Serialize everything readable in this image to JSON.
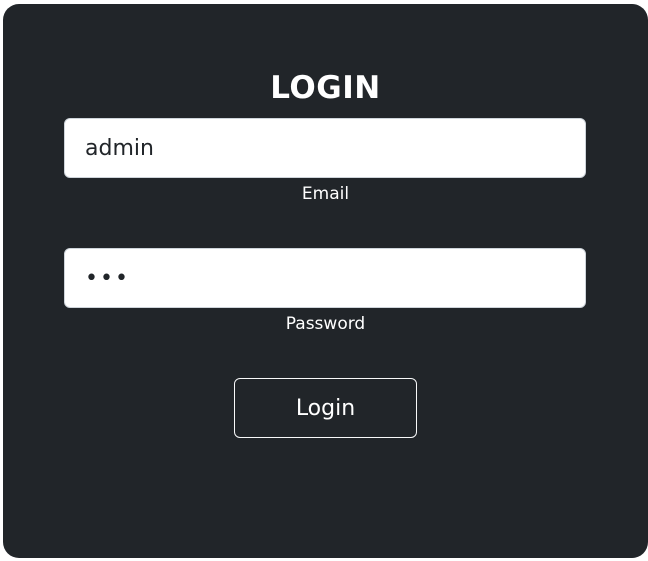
{
  "form": {
    "title": "LOGIN",
    "email": {
      "value": "admin",
      "label": "Email"
    },
    "password": {
      "value": "abc",
      "label": "Password"
    },
    "submit_label": "Login"
  },
  "colors": {
    "card_background": "#212529",
    "text": "#ffffff",
    "input_background": "#ffffff",
    "button_border": "#f8f9fa"
  }
}
